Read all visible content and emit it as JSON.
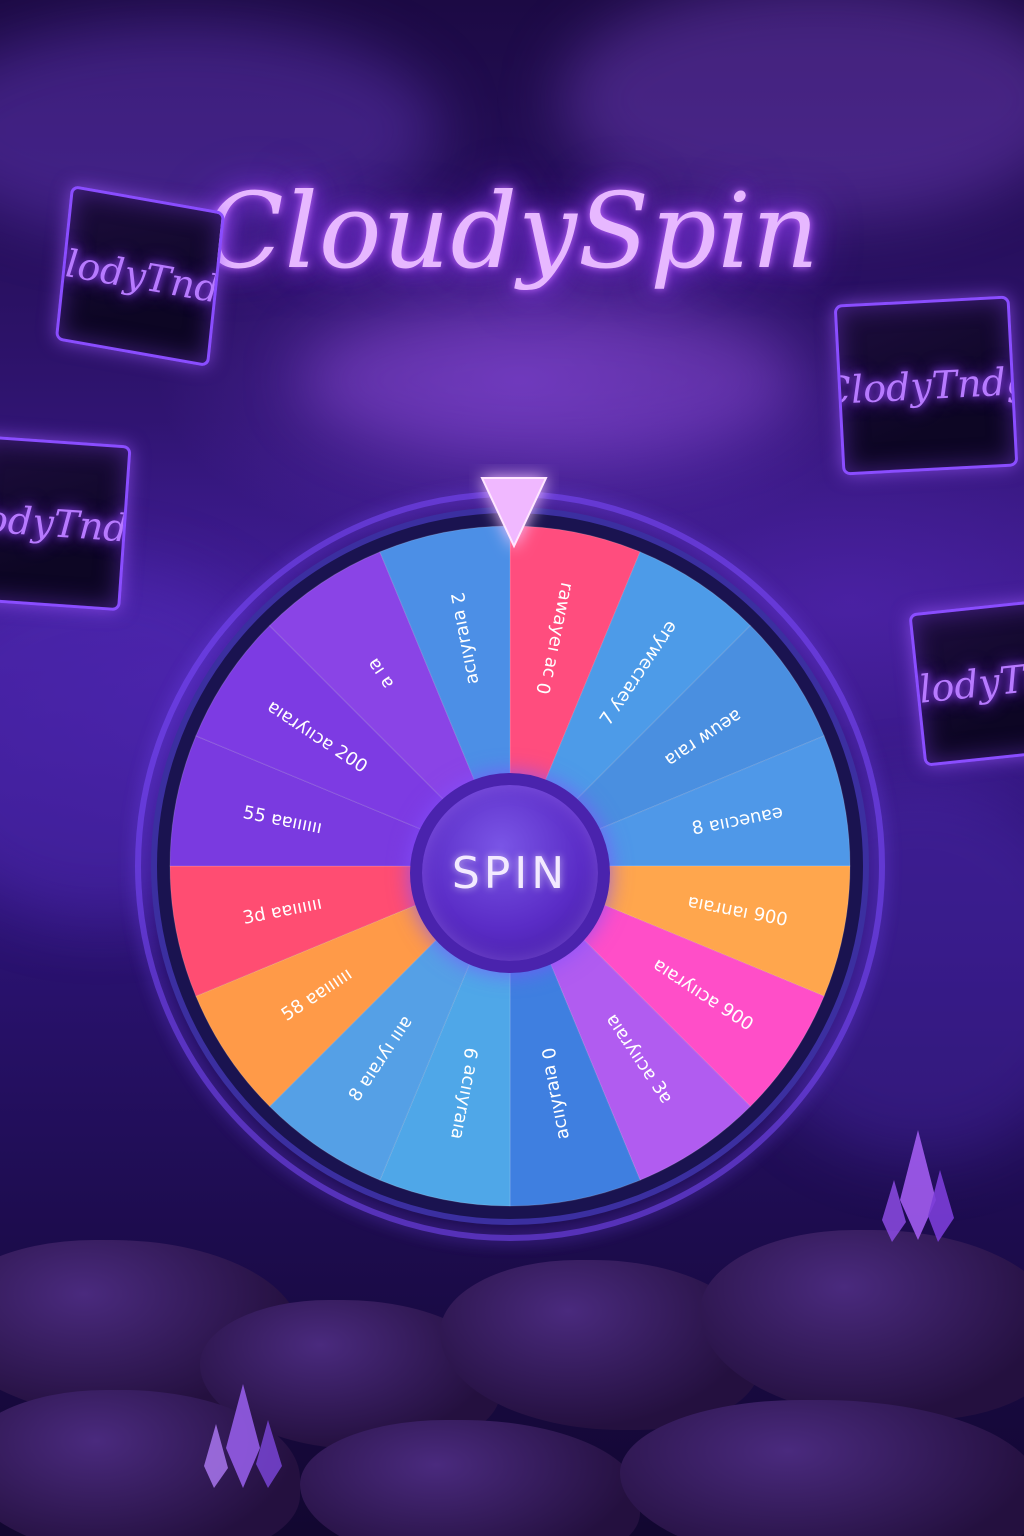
{
  "title": "CloudySpin",
  "signs": [
    {
      "text": "ClodyTndg"
    },
    {
      "text": "ClodyTndg"
    },
    {
      "text": "ClodyTndg"
    },
    {
      "text": "ClodyTndg"
    }
  ],
  "wheel": {
    "spin_label": "SPIN",
    "pointer_color": "#f0b8ff",
    "rim_color": "#1a1350",
    "segments": [
      {
        "label": "0 ɔɐ ıǝʎɐʍɐɹ",
        "color": "#ff4d7e"
      },
      {
        "label": "7 ʎǝɐɹɔǝʍʎɹǝ",
        "color": "#4d9be8"
      },
      {
        "label": "ɐıɐɹ ʍnǝɐ",
        "color": "#4a8fe0"
      },
      {
        "label": "8 ɐııɔǝnɐǝ",
        "color": "#4f98e8"
      },
      {
        "label": "ɐıɐɹuɐı 900",
        "color": "#ffa64d"
      },
      {
        "label": "ɐıɐɹʎııɔɐ 900",
        "color": "#ff4ec8"
      },
      {
        "label": "ɐıɐɹʎııɔɐ 3ɐ",
        "color": "#b15cf0"
      },
      {
        "label": "0 ɐıɐɹʎııɔɐ",
        "color": "#3f7fe0"
      },
      {
        "label": "ɐıɐɹʎııɔɐ 9",
        "color": "#4fa7e8"
      },
      {
        "label": "8 ɐıɐɹʎı ıııɐ",
        "color": "#55a0e6"
      },
      {
        "label": "58 ɐɐıııııı",
        "color": "#ff9a48"
      },
      {
        "label": "3d ɐɐıııııı",
        "color": "#ff4d72"
      },
      {
        "label": "55 ɐɐıııııı",
        "color": "#7a3ae0"
      },
      {
        "label": "ɐıɐɹʎııɔɐ 200",
        "color": "#7d3be3"
      },
      {
        "label": "ɐı ɐ",
        "color": "#8a44e6"
      },
      {
        "label": "2 ɐıɐɹʎııɔɐ",
        "color": "#4c8fe6"
      }
    ]
  }
}
